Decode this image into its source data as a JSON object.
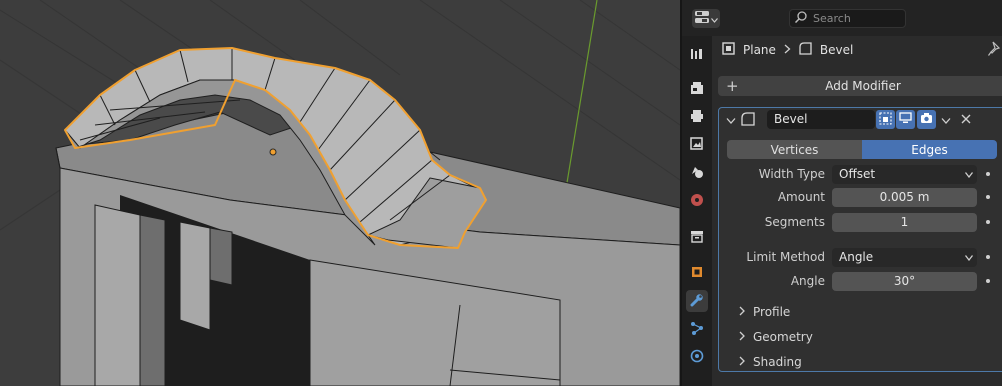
{
  "search": {
    "placeholder": "Search"
  },
  "breadcrumb": {
    "object": "Plane",
    "modifier": "Bevel"
  },
  "add_modifier": {
    "label": "Add Modifier"
  },
  "modifier": {
    "name": "Bevel",
    "mode_tabs": [
      {
        "label": "Vertices",
        "selected": false
      },
      {
        "label": "Edges",
        "selected": true
      }
    ],
    "fields": {
      "width_type": {
        "label": "Width Type",
        "value": "Offset"
      },
      "amount": {
        "label": "Amount",
        "value": "0.005 m"
      },
      "segments": {
        "label": "Segments",
        "value": "1"
      },
      "limit_method": {
        "label": "Limit Method",
        "value": "Angle"
      },
      "angle": {
        "label": "Angle",
        "value": "30°"
      }
    },
    "subpanels": [
      "Profile",
      "Geometry",
      "Shading"
    ]
  },
  "colors": {
    "selection_outline": "#f0a030",
    "accent": "#4772b3",
    "viewport_bg": "#3d3d3d"
  },
  "icons": [
    "editor-type-icon",
    "search-icon",
    "object-icon",
    "modifier-icon",
    "pin-icon",
    "tool-tab-icon",
    "render-tab-icon",
    "output-tab-icon",
    "view-layer-tab-icon",
    "scene-tab-icon",
    "world-tab-icon",
    "collection-tab-icon",
    "object-tab-icon",
    "modifier-tab-icon",
    "particles-tab-icon",
    "physics-tab-icon"
  ]
}
